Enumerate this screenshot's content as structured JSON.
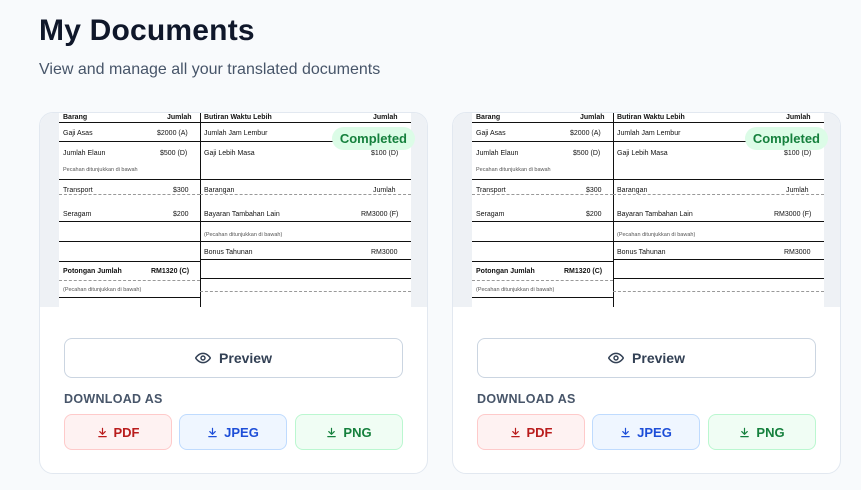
{
  "page": {
    "title": "My Documents",
    "subtitle": "View and manage all your translated documents"
  },
  "documents": [
    {
      "status": "Completed",
      "preview_label": "Preview",
      "download_label": "DOWNLOAD AS",
      "formats": [
        "PDF",
        "JPEG",
        "PNG"
      ],
      "thumbnail": {
        "left": {
          "header_item": "Barang",
          "header_amount": "Jumlah",
          "rows": [
            {
              "label": "Gaji Asas",
              "amount": "$2000 (A)"
            },
            {
              "label": "Jumlah Elaun",
              "amount": "$500 (D)"
            },
            {
              "label": "Pecahan ditunjukkan di bawah",
              "amount": ""
            },
            {
              "label": "Transport",
              "amount": "$300"
            },
            {
              "label": "Seragam",
              "amount": "$200"
            },
            {
              "label": "Potongan Jumlah",
              "amount": "RM1320 (C)"
            },
            {
              "label": "(Pecahan ditunjukkan di bawah)",
              "amount": ""
            }
          ]
        },
        "right": {
          "header_item": "Butiran Waktu Lebih",
          "header_amount": "Jumlah",
          "rows": [
            {
              "label": "Jumlah Jam Lembur",
              "amount": ""
            },
            {
              "label": "Gaji Lebih Masa",
              "amount": "$100 (D)"
            },
            {
              "label": "Barangan",
              "amount": "Jumlah"
            },
            {
              "label": "Bayaran Tambahan Lain",
              "amount": "RM3000 (F)"
            },
            {
              "label": "(Pecahan ditunjukkan di bawah)",
              "amount": ""
            },
            {
              "label": "Bonus Tahunan",
              "amount": "RM3000"
            }
          ]
        }
      }
    },
    {
      "status": "Completed",
      "preview_label": "Preview",
      "download_label": "DOWNLOAD AS",
      "formats": [
        "PDF",
        "JPEG",
        "PNG"
      ],
      "thumbnail": {
        "left": {
          "header_item": "Barang",
          "header_amount": "Jumlah",
          "rows": [
            {
              "label": "Gaji Asas",
              "amount": "$2000 (A)"
            },
            {
              "label": "Jumlah Elaun",
              "amount": "$500 (D)"
            },
            {
              "label": "Pecahan ditunjukkan di bawah",
              "amount": ""
            },
            {
              "label": "Transport",
              "amount": "$300"
            },
            {
              "label": "Seragam",
              "amount": "$200"
            },
            {
              "label": "Potongan Jumlah",
              "amount": "RM1320 (C)"
            },
            {
              "label": "(Pecahan ditunjukkan di bawah)",
              "amount": ""
            }
          ]
        },
        "right": {
          "header_item": "Butiran Waktu Lebih",
          "header_amount": "Jumlah",
          "rows": [
            {
              "label": "Jumlah Jam Lembur",
              "amount": ""
            },
            {
              "label": "Gaji Lebih Masa",
              "amount": "$100 (D)"
            },
            {
              "label": "Barangan",
              "amount": "Jumlah"
            },
            {
              "label": "Bayaran Tambahan Lain",
              "amount": "RM3000 (F)"
            },
            {
              "label": "(Pecahan ditunjukkan di bawah)",
              "amount": ""
            },
            {
              "label": "Bonus Tahunan",
              "amount": "RM3000"
            }
          ]
        }
      }
    }
  ]
}
